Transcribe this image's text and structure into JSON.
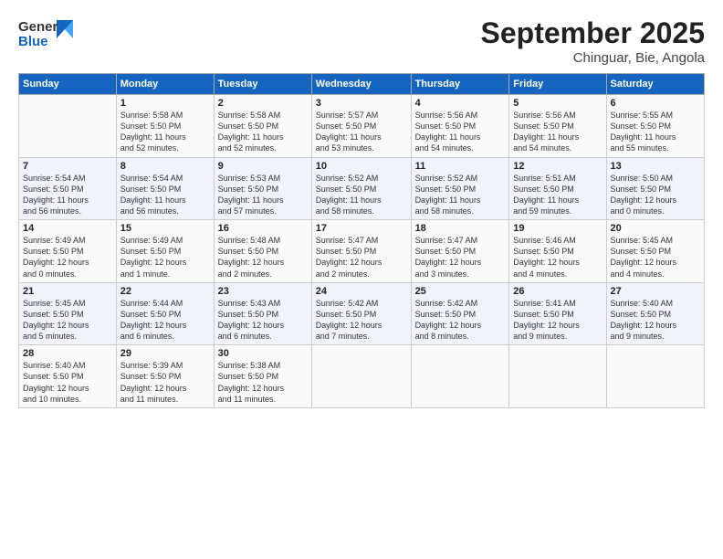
{
  "header": {
    "logo_line1": "General",
    "logo_line2": "Blue",
    "title": "September 2025",
    "subtitle": "Chinguar, Bie, Angola"
  },
  "calendar": {
    "days_of_week": [
      "Sunday",
      "Monday",
      "Tuesday",
      "Wednesday",
      "Thursday",
      "Friday",
      "Saturday"
    ],
    "weeks": [
      [
        {
          "day": "",
          "info": ""
        },
        {
          "day": "1",
          "info": "Sunrise: 5:58 AM\nSunset: 5:50 PM\nDaylight: 11 hours\nand 52 minutes."
        },
        {
          "day": "2",
          "info": "Sunrise: 5:58 AM\nSunset: 5:50 PM\nDaylight: 11 hours\nand 52 minutes."
        },
        {
          "day": "3",
          "info": "Sunrise: 5:57 AM\nSunset: 5:50 PM\nDaylight: 11 hours\nand 53 minutes."
        },
        {
          "day": "4",
          "info": "Sunrise: 5:56 AM\nSunset: 5:50 PM\nDaylight: 11 hours\nand 54 minutes."
        },
        {
          "day": "5",
          "info": "Sunrise: 5:56 AM\nSunset: 5:50 PM\nDaylight: 11 hours\nand 54 minutes."
        },
        {
          "day": "6",
          "info": "Sunrise: 5:55 AM\nSunset: 5:50 PM\nDaylight: 11 hours\nand 55 minutes."
        }
      ],
      [
        {
          "day": "7",
          "info": "Sunrise: 5:54 AM\nSunset: 5:50 PM\nDaylight: 11 hours\nand 56 minutes."
        },
        {
          "day": "8",
          "info": "Sunrise: 5:54 AM\nSunset: 5:50 PM\nDaylight: 11 hours\nand 56 minutes."
        },
        {
          "day": "9",
          "info": "Sunrise: 5:53 AM\nSunset: 5:50 PM\nDaylight: 11 hours\nand 57 minutes."
        },
        {
          "day": "10",
          "info": "Sunrise: 5:52 AM\nSunset: 5:50 PM\nDaylight: 11 hours\nand 58 minutes."
        },
        {
          "day": "11",
          "info": "Sunrise: 5:52 AM\nSunset: 5:50 PM\nDaylight: 11 hours\nand 58 minutes."
        },
        {
          "day": "12",
          "info": "Sunrise: 5:51 AM\nSunset: 5:50 PM\nDaylight: 11 hours\nand 59 minutes."
        },
        {
          "day": "13",
          "info": "Sunrise: 5:50 AM\nSunset: 5:50 PM\nDaylight: 12 hours\nand 0 minutes."
        }
      ],
      [
        {
          "day": "14",
          "info": "Sunrise: 5:49 AM\nSunset: 5:50 PM\nDaylight: 12 hours\nand 0 minutes."
        },
        {
          "day": "15",
          "info": "Sunrise: 5:49 AM\nSunset: 5:50 PM\nDaylight: 12 hours\nand 1 minute."
        },
        {
          "day": "16",
          "info": "Sunrise: 5:48 AM\nSunset: 5:50 PM\nDaylight: 12 hours\nand 2 minutes."
        },
        {
          "day": "17",
          "info": "Sunrise: 5:47 AM\nSunset: 5:50 PM\nDaylight: 12 hours\nand 2 minutes."
        },
        {
          "day": "18",
          "info": "Sunrise: 5:47 AM\nSunset: 5:50 PM\nDaylight: 12 hours\nand 3 minutes."
        },
        {
          "day": "19",
          "info": "Sunrise: 5:46 AM\nSunset: 5:50 PM\nDaylight: 12 hours\nand 4 minutes."
        },
        {
          "day": "20",
          "info": "Sunrise: 5:45 AM\nSunset: 5:50 PM\nDaylight: 12 hours\nand 4 minutes."
        }
      ],
      [
        {
          "day": "21",
          "info": "Sunrise: 5:45 AM\nSunset: 5:50 PM\nDaylight: 12 hours\nand 5 minutes."
        },
        {
          "day": "22",
          "info": "Sunrise: 5:44 AM\nSunset: 5:50 PM\nDaylight: 12 hours\nand 6 minutes."
        },
        {
          "day": "23",
          "info": "Sunrise: 5:43 AM\nSunset: 5:50 PM\nDaylight: 12 hours\nand 6 minutes."
        },
        {
          "day": "24",
          "info": "Sunrise: 5:42 AM\nSunset: 5:50 PM\nDaylight: 12 hours\nand 7 minutes."
        },
        {
          "day": "25",
          "info": "Sunrise: 5:42 AM\nSunset: 5:50 PM\nDaylight: 12 hours\nand 8 minutes."
        },
        {
          "day": "26",
          "info": "Sunrise: 5:41 AM\nSunset: 5:50 PM\nDaylight: 12 hours\nand 9 minutes."
        },
        {
          "day": "27",
          "info": "Sunrise: 5:40 AM\nSunset: 5:50 PM\nDaylight: 12 hours\nand 9 minutes."
        }
      ],
      [
        {
          "day": "28",
          "info": "Sunrise: 5:40 AM\nSunset: 5:50 PM\nDaylight: 12 hours\nand 10 minutes."
        },
        {
          "day": "29",
          "info": "Sunrise: 5:39 AM\nSunset: 5:50 PM\nDaylight: 12 hours\nand 11 minutes."
        },
        {
          "day": "30",
          "info": "Sunrise: 5:38 AM\nSunset: 5:50 PM\nDaylight: 12 hours\nand 11 minutes."
        },
        {
          "day": "",
          "info": ""
        },
        {
          "day": "",
          "info": ""
        },
        {
          "day": "",
          "info": ""
        },
        {
          "day": "",
          "info": ""
        }
      ]
    ]
  }
}
